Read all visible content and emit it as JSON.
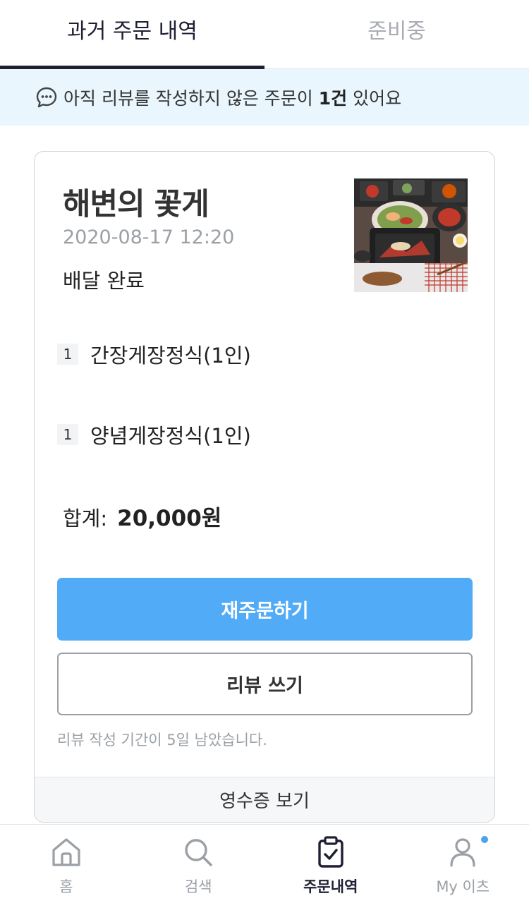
{
  "tabs": {
    "past_orders": "과거 주문 내역",
    "preparing": "준비중"
  },
  "notice": {
    "prefix": "아직 리뷰를 작성하지 않은 주문이 ",
    "count": "1건",
    "suffix": " 있어요"
  },
  "order": {
    "store_name": "해변의 꽃게",
    "date": "2020-08-17 12:20",
    "status": "배달 완료",
    "items": [
      {
        "qty": "1",
        "name": "간장게장정식(1인)"
      },
      {
        "qty": "1",
        "name": "양념게장정식(1인)"
      }
    ],
    "total_label": "합계:",
    "total_value": "20,000원",
    "reorder_label": "재주문하기",
    "review_label": "리뷰 쓰기",
    "review_note": "리뷰 작성 기간이 5일 남았습니다.",
    "receipt_label": "영수증 보기"
  },
  "nav": [
    {
      "label": "홈",
      "icon": "home-icon"
    },
    {
      "label": "검색",
      "icon": "search-icon"
    },
    {
      "label": "주문내역",
      "icon": "clipboard-check-icon"
    },
    {
      "label": "My 이츠",
      "icon": "user-icon"
    }
  ],
  "colors": {
    "primary": "#51abf7",
    "dark": "#1e1f33",
    "notice_bg": "#e9f6fd",
    "badge_dot": "#4aa3ec"
  }
}
